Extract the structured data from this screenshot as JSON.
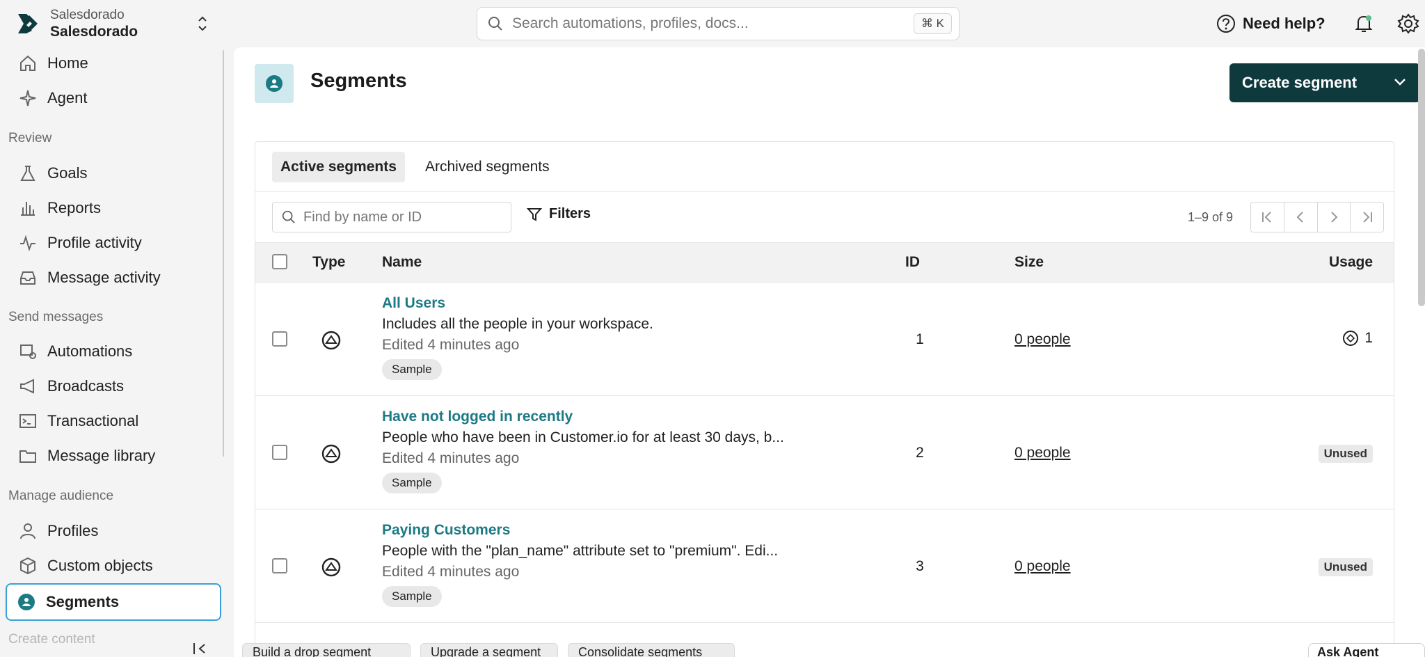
{
  "workspace": {
    "org": "Salesdorado",
    "name": "Salesdorado"
  },
  "sidebar": {
    "top": [
      {
        "label": "Home",
        "icon": "home-icon"
      },
      {
        "label": "Agent",
        "icon": "sparkle-icon"
      }
    ],
    "sections": [
      {
        "label": "Review",
        "items": [
          {
            "label": "Goals",
            "icon": "flask-icon"
          },
          {
            "label": "Reports",
            "icon": "bar-chart-icon"
          },
          {
            "label": "Profile activity",
            "icon": "activity-icon"
          },
          {
            "label": "Message activity",
            "icon": "inbox-icon"
          }
        ]
      },
      {
        "label": "Send messages",
        "items": [
          {
            "label": "Automations",
            "icon": "automation-icon"
          },
          {
            "label": "Broadcasts",
            "icon": "megaphone-icon"
          },
          {
            "label": "Transactional",
            "icon": "terminal-icon"
          },
          {
            "label": "Message library",
            "icon": "folder-icon"
          }
        ]
      },
      {
        "label": "Manage audience",
        "items": [
          {
            "label": "Profiles",
            "icon": "person-icon"
          },
          {
            "label": "Custom objects",
            "icon": "cube-icon"
          },
          {
            "label": "Segments",
            "icon": "segment-icon",
            "active": true
          }
        ]
      },
      {
        "label": "Create content",
        "items": []
      }
    ]
  },
  "topbar": {
    "search_placeholder": "Search automations, profiles, docs...",
    "shortcut": "⌘ K",
    "help_label": "Need help?"
  },
  "page": {
    "title": "Segments",
    "create_label": "Create segment",
    "tabs": [
      "Active segments",
      "Archived segments"
    ],
    "find_placeholder": "Find by name or ID",
    "filters_label": "Filters",
    "pagination": "1–9 of 9",
    "columns": {
      "type": "Type",
      "name": "Name",
      "id": "ID",
      "size": "Size",
      "usage": "Usage"
    },
    "rows": [
      {
        "name": "All Users",
        "desc": "Includes all the people in your workspace.",
        "edited": "Edited 4 minutes ago",
        "tag": "Sample",
        "id": "1",
        "size": "0 people",
        "usage": "1"
      },
      {
        "name": "Have not logged in recently",
        "desc": "People who have been in Customer.io for at least 30 days, b...",
        "edited": "Edited 4 minutes ago",
        "tag": "Sample",
        "id": "2",
        "size": "0 people",
        "usage": "Unused"
      },
      {
        "name": "Paying Customers",
        "desc": "People with the \"plan_name\" attribute set to \"premium\". Edi...",
        "edited": "Edited 4 minutes ago",
        "tag": "Sample",
        "id": "3",
        "size": "0 people",
        "usage": "Unused"
      }
    ]
  },
  "bottom_bar": {
    "chips": [
      "Build a drop segment",
      "Upgrade a segment",
      "Consolidate segments"
    ],
    "ask": "Ask Agent"
  },
  "colors": {
    "accent": "#0e3a3e",
    "link": "#1c7a84",
    "active_border": "#3aa0d8"
  }
}
